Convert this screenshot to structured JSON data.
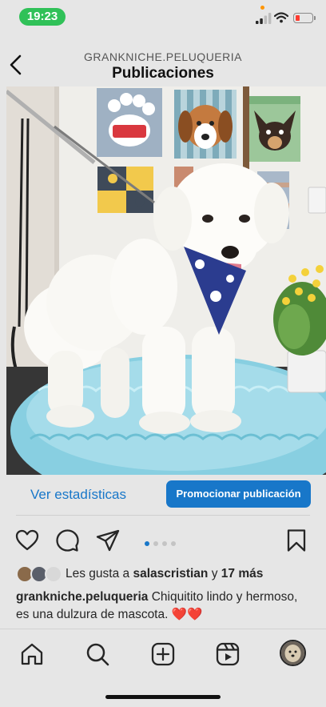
{
  "status_bar": {
    "time": "19:23",
    "icons": [
      "cellular-signal-icon",
      "wifi-icon",
      "battery-low-icon"
    ]
  },
  "header": {
    "username": "GRANKNICHE.PELUQUERIA",
    "title": "Publicaciones",
    "back_icon": "chevron-left-icon"
  },
  "post": {
    "image_subject": "white poodle wearing a blue bandana on a grooming table",
    "insights_label": "Ver estadísticas",
    "promote_label": "Promocionar publicación",
    "carousel": {
      "count": 4,
      "active": 0
    },
    "likes": {
      "prefix": "Les gusta a",
      "user": "salascristian",
      "connector": "y",
      "others": "17 más"
    },
    "caption": {
      "username": "grankniche.peluqueria",
      "text": "Chiquitito lindo y hermoso, es una dulzura de mascota. ❤️❤️"
    }
  },
  "action_icons": [
    "heart-icon",
    "comment-icon",
    "share-icon",
    "bookmark-icon"
  ],
  "tab_bar": [
    "home-icon",
    "search-icon",
    "new-post-icon",
    "reels-icon",
    "profile-avatar"
  ],
  "colors": {
    "accent": "#1877c9",
    "time_pill": "#30c158",
    "background": "#e6e6e6"
  }
}
